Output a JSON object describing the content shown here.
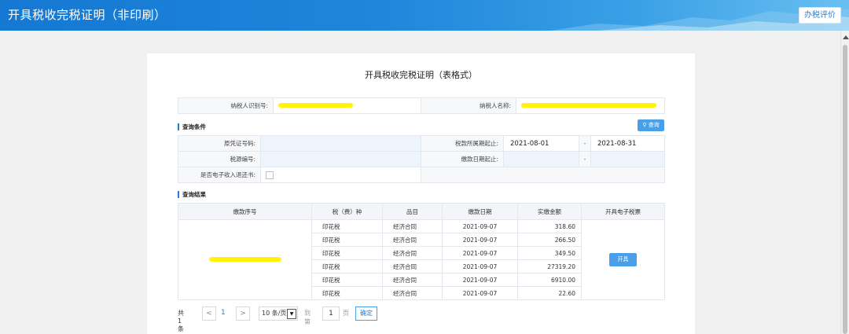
{
  "header": {
    "title": "开具税收完税证明（非印刷）",
    "rate_button": "办税评价"
  },
  "page": {
    "title": "开具税收完税证明（表格式）"
  },
  "taxpayer": {
    "id_label": "纳税人识别号:",
    "name_label": "纳税人名称:"
  },
  "conditions": {
    "section_title": "查询条件",
    "query_button": "查询",
    "voucher_label": "原凭证号码:",
    "period_label": "税款所属期起止:",
    "period_start": "2021-08-01",
    "period_end": "2021-08-31",
    "range_sep": "-",
    "source_label": "税源编号:",
    "paydate_label": "缴款日期起止:",
    "refund_label": "是否电子收入退还书:"
  },
  "results": {
    "section_title": "查询结果",
    "columns": [
      "缴款序号",
      "税（费）种",
      "品目",
      "缴款日期",
      "实缴金额",
      "开具电子税票"
    ],
    "rows": [
      {
        "tax": "印花税",
        "item": "经济合同",
        "date": "2021-09-07",
        "amount": "318.60"
      },
      {
        "tax": "印花税",
        "item": "经济合同",
        "date": "2021-09-07",
        "amount": "266.50"
      },
      {
        "tax": "印花税",
        "item": "经济合同",
        "date": "2021-09-07",
        "amount": "349.50"
      },
      {
        "tax": "印花税",
        "item": "经济合同",
        "date": "2021-09-07",
        "amount": "27319.20"
      },
      {
        "tax": "印花税",
        "item": "经济合同",
        "date": "2021-09-07",
        "amount": "6910.00"
      },
      {
        "tax": "印花税",
        "item": "经济合同",
        "date": "2021-09-07",
        "amount": "22.60"
      }
    ],
    "issue_button": "开具"
  },
  "pager": {
    "total": "共 1 条",
    "prev": "<",
    "current_page": "1",
    "next": ">",
    "page_size": "10 条/页",
    "goto_label": "到第",
    "goto_value": "1",
    "page_unit": "页",
    "confirm": "确定"
  },
  "colors": {
    "accent": "#1e7fd8",
    "button": "#4a9fe9",
    "redaction": "#fff200"
  }
}
